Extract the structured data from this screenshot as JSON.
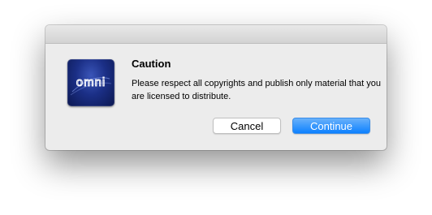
{
  "dialog": {
    "heading": "Caution",
    "message": "Please respect all copyrights and publish only material that you are licensed to distribute.",
    "app_icon": "omni-app-icon",
    "app_icon_text": "omni"
  },
  "buttons": {
    "cancel_label": "Cancel",
    "continue_label": "Continue"
  },
  "colors": {
    "dialog_background": "#ececec",
    "primary_button": "#1a86fb",
    "icon_background": "#1b2f86"
  }
}
